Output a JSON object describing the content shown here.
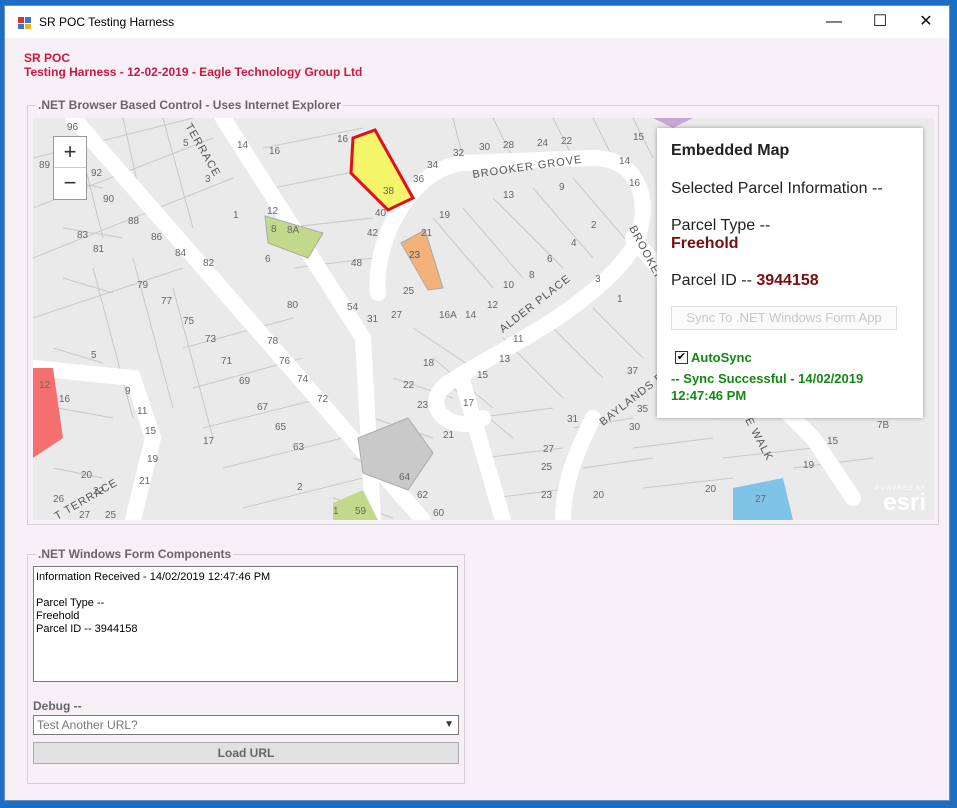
{
  "window": {
    "title": "SR POC Testing Harness",
    "minimize_glyph": "—",
    "maximize_glyph": "☐",
    "close_glyph": "✕"
  },
  "header": {
    "line1": "SR POC",
    "line2": "Testing Harness - 12-02-2019 - Eagle Technology Group Ltd"
  },
  "browser_group": {
    "title": ".NET Browser Based Control - Uses Internet Explorer"
  },
  "map": {
    "zoom_in": "+",
    "zoom_out": "−",
    "roads": [
      "BROOKER GROVE",
      "TERRACE",
      "ALDER PLACE",
      "BROOKER",
      "BAYLANDS D",
      "E WALK",
      "T TERRACE"
    ],
    "parcel_numbers": [
      "96",
      "89",
      "92",
      "90",
      "88",
      "86",
      "84",
      "82",
      "83",
      "81",
      "79",
      "77",
      "75",
      "73",
      "71",
      "69",
      "67",
      "65",
      "63",
      "2",
      "1",
      "3",
      "5",
      "4",
      "12",
      "14",
      "16",
      "18",
      "20",
      "22",
      "23",
      "25",
      "26",
      "28",
      "30",
      "32",
      "24",
      "34",
      "36",
      "38",
      "40",
      "42",
      "48",
      "52",
      "54",
      "56",
      "60",
      "62",
      "64",
      "72",
      "74",
      "76",
      "78",
      "80",
      "9",
      "11",
      "13",
      "15",
      "17",
      "19",
      "21",
      "27",
      "31",
      "37",
      "8",
      "6",
      "10",
      "8A",
      "6A",
      "59",
      "7B",
      "29"
    ],
    "selected_parcel_label": "38",
    "neighbor_parcel_label": "23",
    "attribution_small": "POWERED BY",
    "attribution_big": "esri"
  },
  "info_panel": {
    "title": "Embedded Map",
    "selected_heading": "Selected Parcel Information --",
    "parcel_type_label": "Parcel Type --",
    "parcel_type_value": "Freehold",
    "parcel_id_label": "Parcel ID --",
    "parcel_id_value": "3944158",
    "sync_button": "Sync To .NET Windows Form App",
    "autosync_label": "AutoSync",
    "autosync_checked": true,
    "sync_status": "-- Sync Successful - 14/02/2019 12:47:46 PM"
  },
  "form_group": {
    "title": ".NET Windows Form Components",
    "textarea_lines": [
      "Information Received - 14/02/2019 12:47:46 PM",
      "",
      "Parcel Type --",
      "Freehold",
      "Parcel ID -- 3944158"
    ],
    "debug_label": "Debug --",
    "url_placeholder": "Test Another URL?",
    "load_button": "Load URL"
  },
  "colors": {
    "header_red": "#cc1840",
    "selected_parcel_fill": "#f5f56a",
    "selected_parcel_stroke": "#e0101a",
    "sync_green": "#128a12",
    "freehold_dark_red": "#7a0e0e"
  }
}
